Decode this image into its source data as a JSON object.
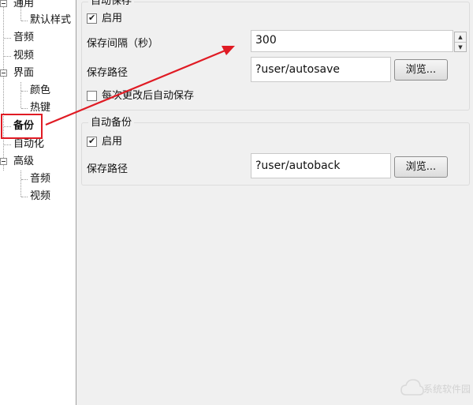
{
  "tree": {
    "items": [
      {
        "label": "通用"
      },
      {
        "label": "默认样式"
      },
      {
        "label": "音频"
      },
      {
        "label": "视频"
      },
      {
        "label": "界面"
      },
      {
        "label": "颜色"
      },
      {
        "label": "热键"
      },
      {
        "label": "备份"
      },
      {
        "label": "自动化"
      },
      {
        "label": "高级"
      },
      {
        "label": "音频"
      },
      {
        "label": "视频"
      }
    ]
  },
  "autosave": {
    "group_title": "自动保存",
    "enable_label": "启用",
    "enabled": true,
    "interval_label": "保存间隔（秒）",
    "interval_value": "300",
    "path_label": "保存路径",
    "path_value": "?user/autosave",
    "browse_label": "浏览...",
    "save_on_change_label": "每次更改后自动保存",
    "save_on_change": false
  },
  "autobackup": {
    "group_title": "自动备份",
    "enable_label": "启用",
    "enabled": true,
    "path_label": "保存路径",
    "path_value": "?user/autoback",
    "browse_label": "浏览..."
  },
  "annotation": {
    "highlight_color": "#e01b24"
  },
  "watermark": {
    "text": "系统软件园"
  }
}
